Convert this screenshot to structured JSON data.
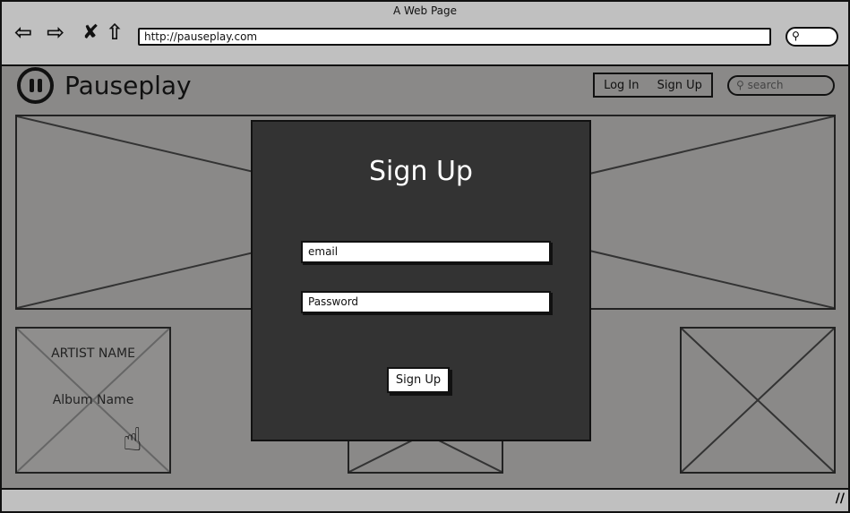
{
  "browser": {
    "title": "A Web Page",
    "url": "http://pauseplay.com",
    "icons": [
      "back-arrow-icon",
      "forward-arrow-icon",
      "close-x-icon",
      "home-icon",
      "search-icon"
    ]
  },
  "header": {
    "brand": "Pauseplay",
    "login": "Log In",
    "signup": "Sign Up",
    "search_placeholder": "search"
  },
  "modal": {
    "title": "Sign Up",
    "email_placeholder": "email",
    "password_placeholder": "Password",
    "submit": "Sign Up"
  },
  "card": {
    "artist": "ARTIST NAME",
    "album": "Album Name"
  },
  "colors": {
    "page": "#8a8988",
    "modal": "#333333",
    "chrome": "#c0c0c0"
  }
}
